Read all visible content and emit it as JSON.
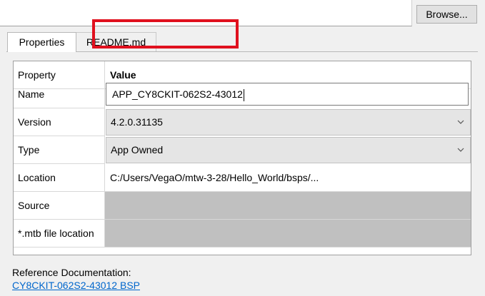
{
  "toolbar": {
    "browse_label": "Browse..."
  },
  "tabs": [
    {
      "label": "Properties",
      "active": true
    },
    {
      "label": "README.md",
      "active": false
    }
  ],
  "grid": {
    "headers": {
      "property": "Property",
      "value": "Value"
    },
    "rows": [
      {
        "name": "Name",
        "value": "APP_CY8CKIT-062S2-43012",
        "kind": "text-input"
      },
      {
        "name": "Version",
        "value": "4.2.0.31135",
        "kind": "dropdown"
      },
      {
        "name": "Type",
        "value": "App Owned",
        "kind": "dropdown"
      },
      {
        "name": "Location",
        "value": "C:/Users/VegaO/mtw-3-28/Hello_World/bsps/...",
        "kind": "text"
      },
      {
        "name": "Source",
        "value": "",
        "kind": "disabled"
      },
      {
        "name": "*.mtb file location",
        "value": "",
        "kind": "disabled"
      }
    ]
  },
  "reference": {
    "label": "Reference Documentation:",
    "link": "CY8CKIT-062S2-43012 BSP"
  },
  "colors": {
    "highlight": "#e0101e",
    "link": "#0066cc",
    "disabled_cell": "#c0c0c0"
  }
}
